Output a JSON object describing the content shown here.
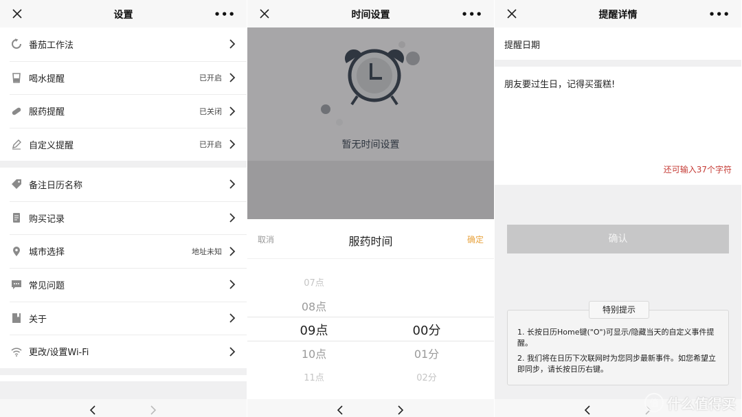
{
  "settings": {
    "title": "设置",
    "more": "•••",
    "group1": [
      {
        "icon": "tomato-timer-icon",
        "label": "番茄工作法",
        "status": ""
      },
      {
        "icon": "water-cup-icon",
        "label": "喝水提醒",
        "status": "已开启"
      },
      {
        "icon": "pill-icon",
        "label": "服药提醒",
        "status": "已关闭"
      },
      {
        "icon": "pencil-icon",
        "label": "自定义提醒",
        "status": "已开启"
      }
    ],
    "group2": [
      {
        "icon": "tag-icon",
        "label": "备注日历名称",
        "status": ""
      },
      {
        "icon": "receipt-icon",
        "label": "购买记录",
        "status": ""
      },
      {
        "icon": "location-pin-icon",
        "label": "城市选择",
        "status": "地址未知"
      },
      {
        "icon": "chat-bubble-icon",
        "label": "常见问题",
        "status": ""
      },
      {
        "icon": "bookmark-icon",
        "label": "关于",
        "status": ""
      },
      {
        "icon": "wifi-icon",
        "label": "更改/设置Wi-Fi",
        "status": ""
      }
    ]
  },
  "time_settings": {
    "title": "时间设置",
    "more": "•••",
    "empty_text": "暂无时间设置",
    "picker": {
      "cancel": "取消",
      "title": "服药时间",
      "confirm": "确定",
      "hours": [
        "07点",
        "08点",
        "09点",
        "10点",
        "11点"
      ],
      "minutes": [
        "00分",
        "01分",
        "02分"
      ],
      "selected_hour": "09点",
      "selected_minute": "00分"
    }
  },
  "reminder_detail": {
    "title": "提醒详情",
    "more": "•••",
    "date_label": "提醒日期",
    "note": "朋友要过生日，记得买蛋糕!",
    "remaining": "还可输入37个字符",
    "confirm": "确认",
    "tip_title": "特别提示",
    "tips": [
      "1. 长按日历Home键(\"O\")可显示/隐藏当天的自定义事件提醒。",
      "2. 我们将在日历下次联网时为您同步最新事件。如您希望立即同步，请长按日历右键。"
    ]
  },
  "watermark": {
    "text": "什么值得买",
    "logo_glyph": "值"
  },
  "colors": {
    "accent_orange": "#e8a33e",
    "warning_red": "#c53b35",
    "overlay_gray": "#a7a6a8",
    "button_gray": "#c7c7c8"
  }
}
